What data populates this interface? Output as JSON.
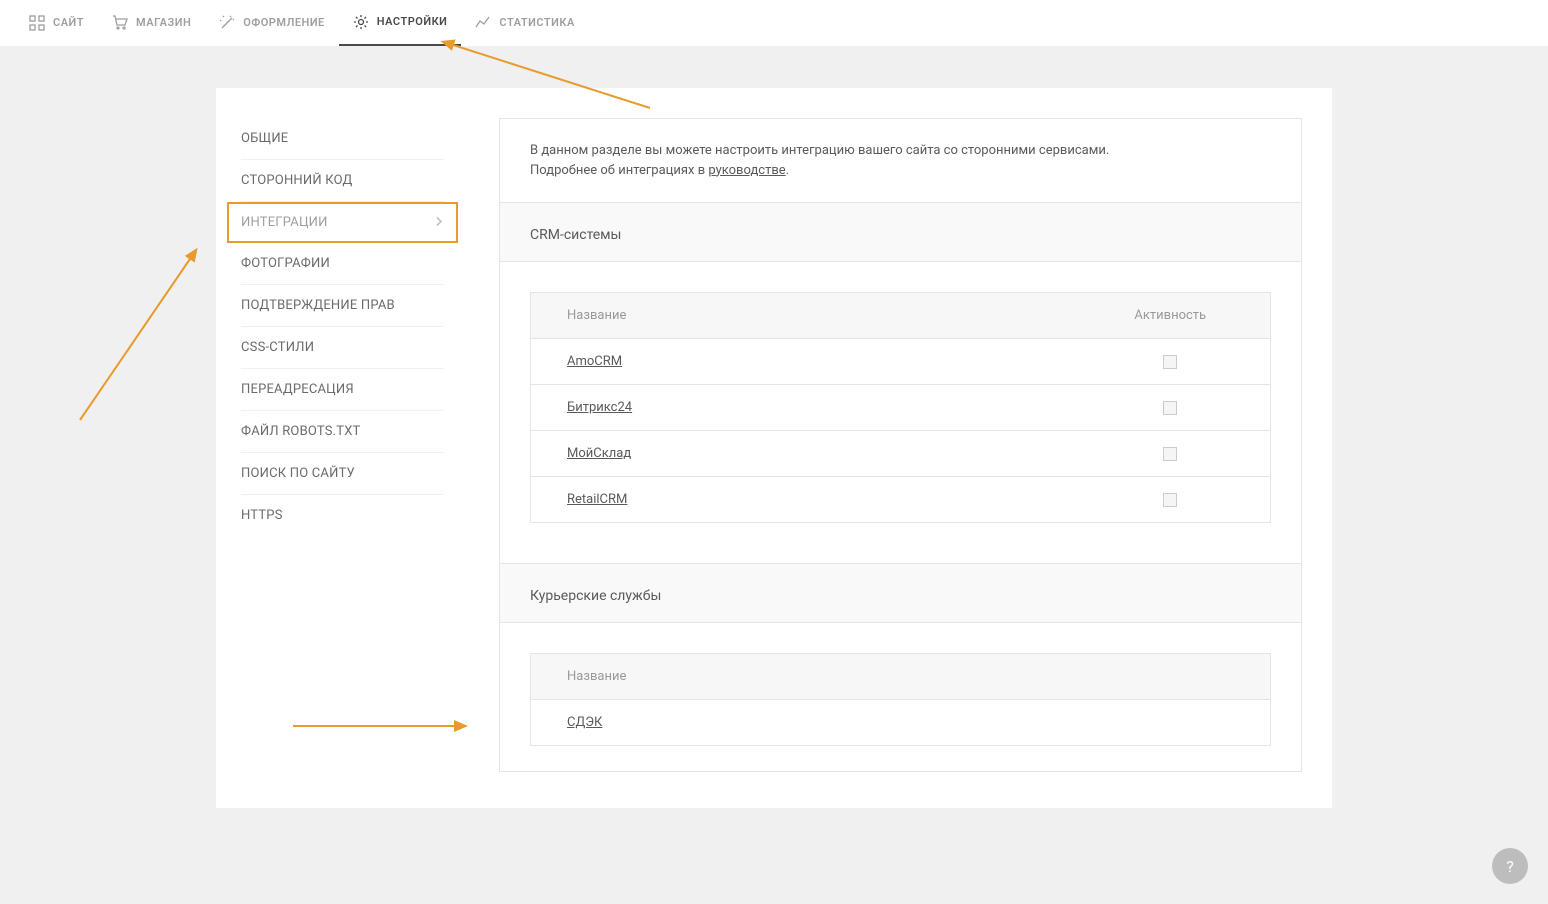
{
  "nav": {
    "items": [
      {
        "label": "САЙТ",
        "active": false
      },
      {
        "label": "МАГАЗИН",
        "active": false
      },
      {
        "label": "ОФОРМЛЕНИЕ",
        "active": false
      },
      {
        "label": "НАСТРОЙКИ",
        "active": true
      },
      {
        "label": "СТАТИСТИКА",
        "active": false
      }
    ]
  },
  "sidebar": {
    "items": [
      {
        "label": "ОБЩИЕ"
      },
      {
        "label": "СТОРОННИЙ КОД"
      },
      {
        "label": "ИНТЕГРАЦИИ",
        "highlighted": true
      },
      {
        "label": "ФОТОГРАФИИ"
      },
      {
        "label": "ПОДТВЕРЖДЕНИЕ ПРАВ"
      },
      {
        "label": "CSS-СТИЛИ"
      },
      {
        "label": "ПЕРЕАДРЕСАЦИЯ"
      },
      {
        "label": "ФАЙЛ ROBOTS.TXT"
      },
      {
        "label": "ПОИСК ПО САЙТУ"
      },
      {
        "label": "HTTPS"
      }
    ]
  },
  "info": {
    "line1": "В данном разделе вы можете настроить интеграцию вашего сайта со сторонними сервисами.",
    "line2a": "Подробнее об интеграциях в ",
    "link": "руководстве",
    "line2b": "."
  },
  "sections": {
    "crm": {
      "title": "CRM-системы",
      "columns": {
        "name": "Название",
        "activity": "Активность"
      },
      "rows": [
        {
          "name": "AmoCRM",
          "active": false
        },
        {
          "name": "Битрикс24",
          "active": false
        },
        {
          "name": "МойСклад",
          "active": false
        },
        {
          "name": "RetailCRM",
          "active": false
        }
      ]
    },
    "courier": {
      "title": "Курьерские службы",
      "columns": {
        "name": "Название"
      },
      "rows": [
        {
          "name": "СДЭК"
        }
      ]
    }
  },
  "help": "?"
}
